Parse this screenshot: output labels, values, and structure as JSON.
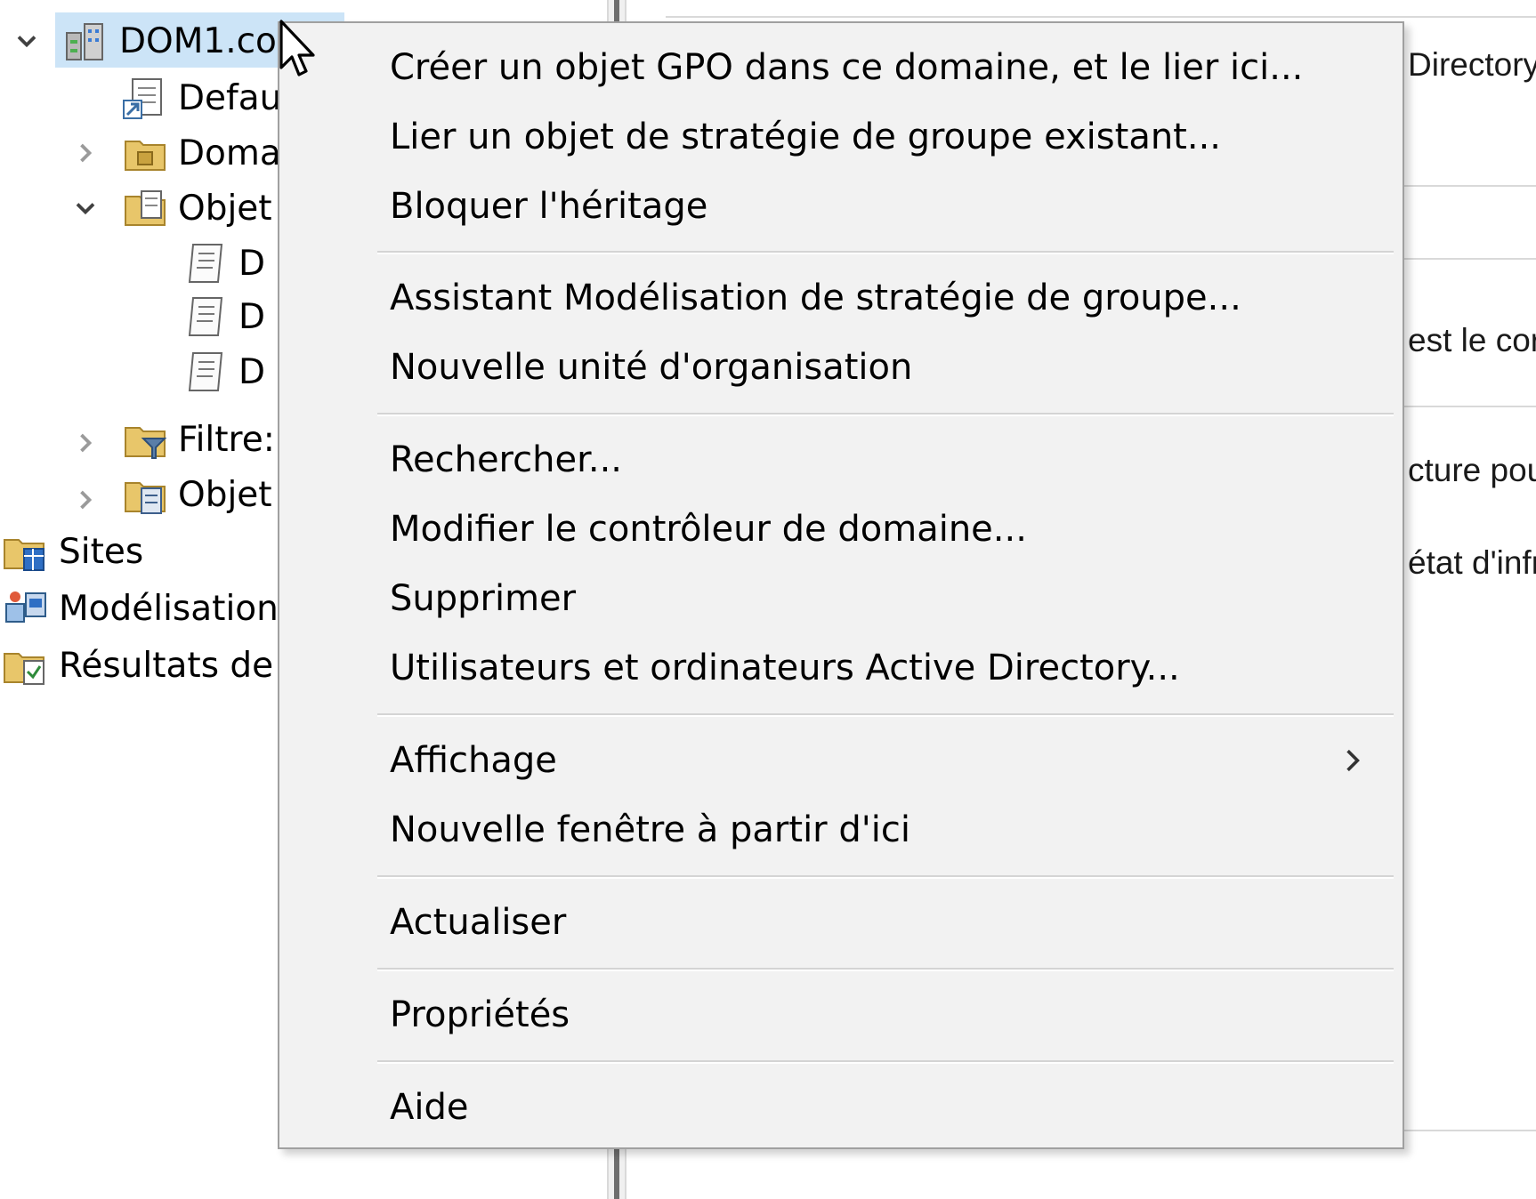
{
  "tree": {
    "items": [
      {
        "label": "DOM1.co",
        "icon": "domain-icon",
        "expanded": true,
        "selected": true
      },
      {
        "label": "Defau",
        "icon": "gpo-link-icon"
      },
      {
        "label": "Doma",
        "icon": "ou-folder-icon",
        "expanded": false
      },
      {
        "label": "Objet",
        "icon": "gpo-folder-icon",
        "expanded": true
      },
      {
        "label": "D",
        "icon": "gpo-scroll-icon"
      },
      {
        "label": "D",
        "icon": "gpo-scroll-icon"
      },
      {
        "label": "D",
        "icon": "gpo-scroll-icon"
      },
      {
        "label": "Filtre:",
        "icon": "wmi-filter-folder-icon",
        "expanded": false
      },
      {
        "label": "Objet",
        "icon": "starter-gpo-folder-icon",
        "expanded": false
      },
      {
        "label": "Sites",
        "icon": "sites-folder-icon"
      },
      {
        "label": "Modélisation",
        "icon": "modeling-icon"
      },
      {
        "label": "Résultats de",
        "icon": "results-icon"
      }
    ]
  },
  "right_pane": {
    "texts": [
      "Directory",
      "est le cor",
      "cture pou",
      "état d'infr"
    ]
  },
  "context_menu": {
    "items": [
      "Créer un objet GPO dans ce domaine, et le lier ici...",
      "Lier un objet de stratégie de groupe existant...",
      "Bloquer l'héritage",
      "Assistant Modélisation de stratégie de groupe...",
      "Nouvelle unité d'organisation",
      "Rechercher...",
      "Modifier le contrôleur de domaine...",
      "Supprimer",
      "Utilisateurs et ordinateurs Active Directory...",
      "Affichage",
      "Nouvelle fenêtre à partir d'ici",
      "Actualiser",
      "Propriétés",
      "Aide"
    ]
  },
  "colors": {
    "selection": "#cce4f7",
    "menu_background": "#f2f2f2",
    "menu_border": "#a0a0a0"
  }
}
